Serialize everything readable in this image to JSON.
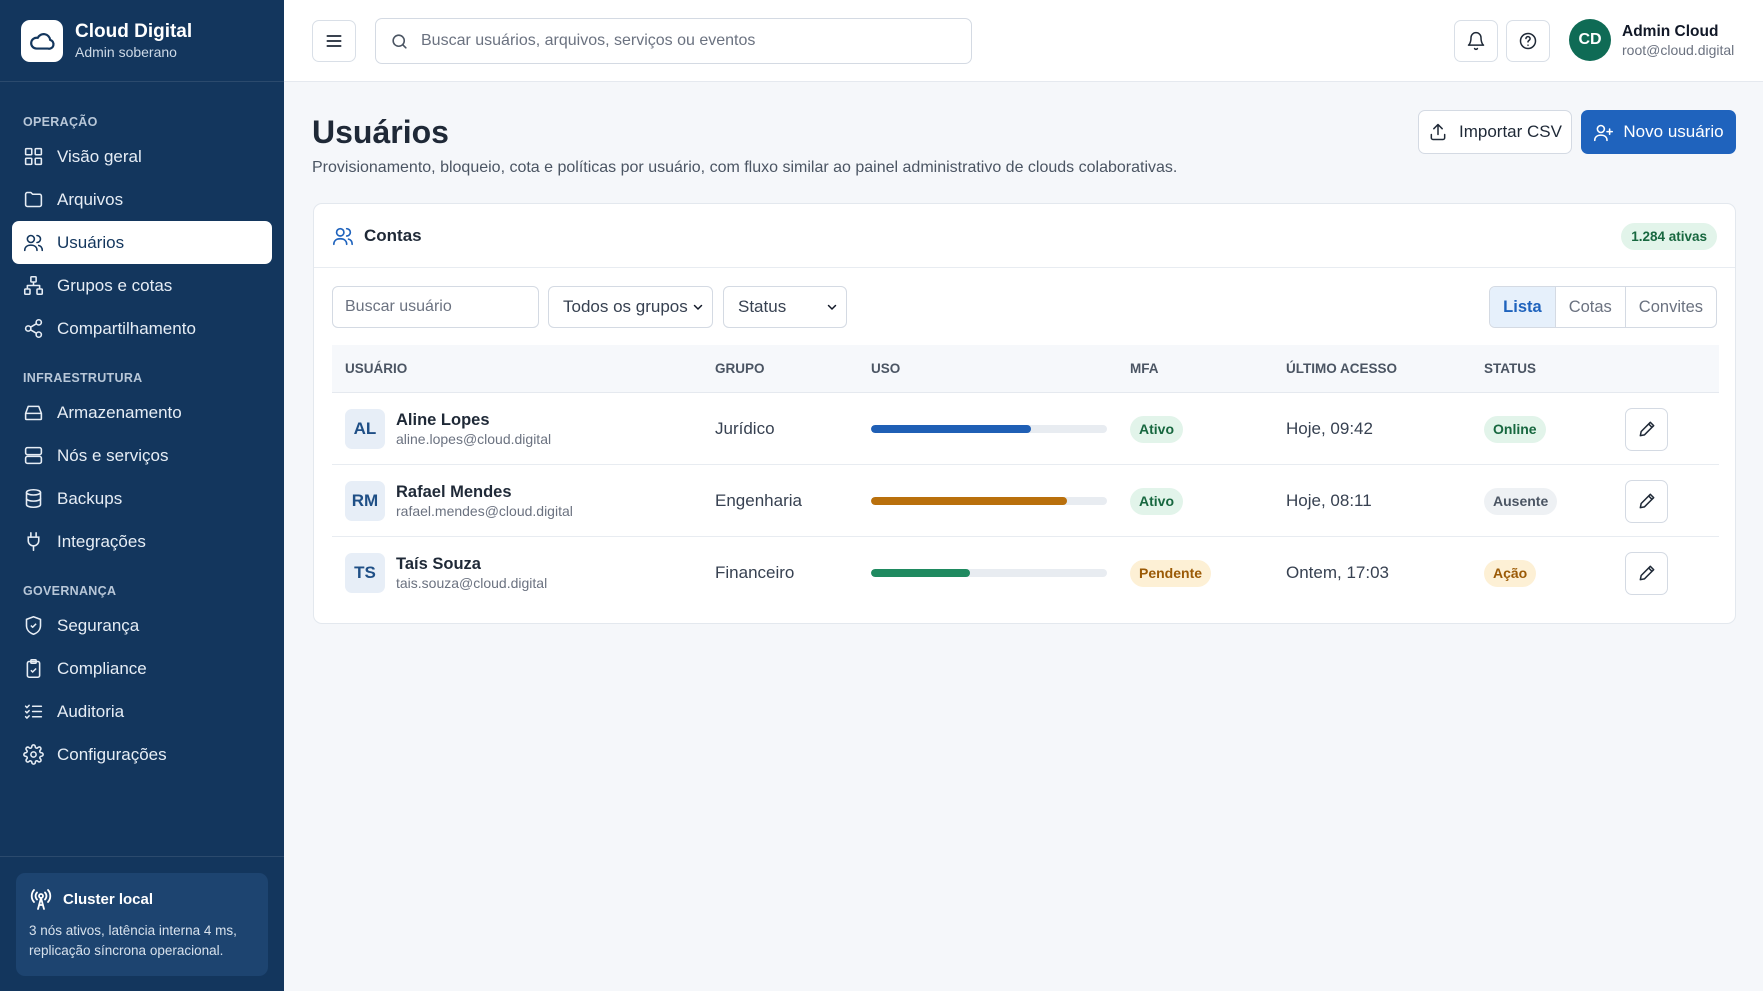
{
  "brand": {
    "title": "Cloud Digital",
    "subtitle": "Admin soberano"
  },
  "sidebar": {
    "sections": [
      {
        "label": "OPERAÇÃO"
      },
      {
        "label": "INFRAESTRUTURA"
      },
      {
        "label": "GOVERNANÇA"
      }
    ],
    "items": [
      {
        "label": "Visão geral",
        "icon": "grid-icon"
      },
      {
        "label": "Arquivos",
        "icon": "folder-icon"
      },
      {
        "label": "Usuários",
        "icon": "users-icon",
        "active": true
      },
      {
        "label": "Grupos e cotas",
        "icon": "groups-icon"
      },
      {
        "label": "Compartilhamento",
        "icon": "share-icon"
      },
      {
        "label": "Armazenamento",
        "icon": "storage-icon"
      },
      {
        "label": "Nós e serviços",
        "icon": "server-icon"
      },
      {
        "label": "Backups",
        "icon": "database-icon"
      },
      {
        "label": "Integrações",
        "icon": "plug-icon"
      },
      {
        "label": "Segurança",
        "icon": "shield-icon"
      },
      {
        "label": "Compliance",
        "icon": "clipboard-check-icon"
      },
      {
        "label": "Auditoria",
        "icon": "list-check-icon"
      },
      {
        "label": "Configurações",
        "icon": "gear-icon"
      }
    ],
    "cluster": {
      "title": "Cluster local",
      "description": "3 nós ativos, latência interna 4 ms, replicação síncrona operacional."
    }
  },
  "topbar": {
    "search_placeholder": "Buscar usuários, arquivos, serviços ou eventos",
    "user": {
      "initials": "CD",
      "name": "Admin Cloud",
      "email": "root@cloud.digital"
    }
  },
  "page": {
    "title": "Usuários",
    "subtitle": "Provisionamento, bloqueio, cota e políticas por usuário, com fluxo similar ao painel administrativo de clouds colaborativas.",
    "import_label": "Importar CSV",
    "new_user_label": "Novo usuário"
  },
  "accounts": {
    "title": "Contas",
    "badge": "1.284 ativas",
    "search_placeholder": "Buscar usuário",
    "group_filter": "Todos os grupos",
    "status_filter": "Status",
    "views": [
      "Lista",
      "Cotas",
      "Convites"
    ],
    "active_view": "Lista",
    "columns": {
      "user": "USUÁRIO",
      "group": "GRUPO",
      "usage": "USO",
      "mfa": "MFA",
      "last_access": "ÚLTIMO ACESSO",
      "status": "STATUS"
    },
    "rows": [
      {
        "initials": "AL",
        "name": "Aline Lopes",
        "email": "aline.lopes@cloud.digital",
        "group": "Jurídico",
        "usage": 0.68,
        "mfa": "Ativo",
        "last_access": "Hoje, 09:42",
        "status": "Online"
      },
      {
        "initials": "RM",
        "name": "Rafael Mendes",
        "email": "rafael.mendes@cloud.digital",
        "group": "Engenharia",
        "usage": 0.83,
        "mfa": "Ativo",
        "last_access": "Hoje, 08:11",
        "status": "Ausente"
      },
      {
        "initials": "TS",
        "name": "Taís Souza",
        "email": "tais.souza@cloud.digital",
        "group": "Financeiro",
        "usage": 0.42,
        "mfa": "Pendente",
        "last_access": "Ontem, 17:03",
        "status": "Ação"
      }
    ]
  },
  "colors": {
    "sidebar_bg": "#13365d",
    "primary": "#1f63bd",
    "usage_blue": "#1f5fb5",
    "usage_amber": "#b9700c",
    "usage_green": "#1f8a60"
  }
}
